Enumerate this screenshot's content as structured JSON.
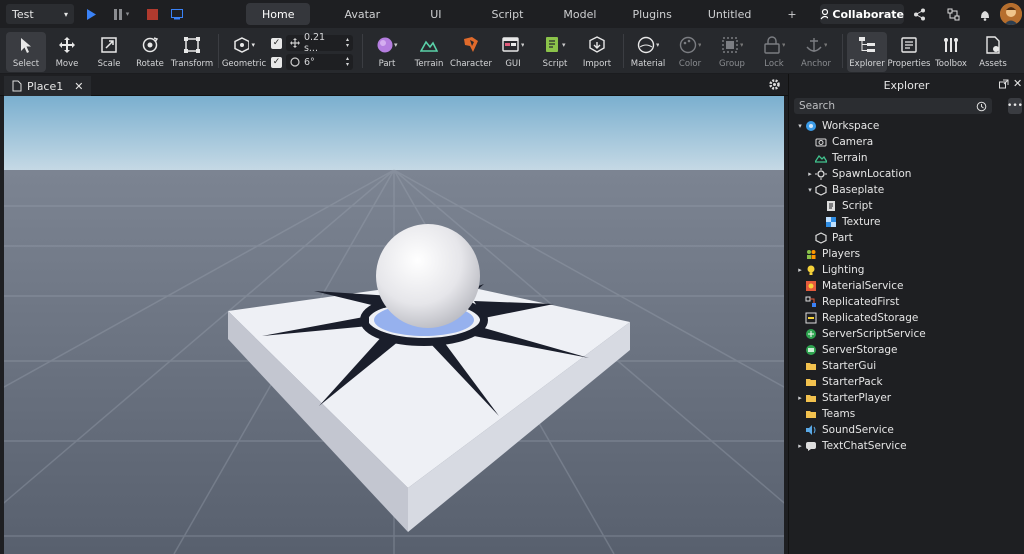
{
  "topbar": {
    "mode": "Test",
    "tabs": [
      "Home",
      "Avatar",
      "UI",
      "Script",
      "Model",
      "Plugins",
      "Untitled",
      "+"
    ],
    "active_tab": "Home",
    "collaborate_label": "Collaborate"
  },
  "ribbon": {
    "tools": [
      "Select",
      "Move",
      "Scale",
      "Rotate",
      "Transform"
    ],
    "geometric_label": "Geometric",
    "snap_move_value": "0.21 s...",
    "snap_rotate_value": "6°",
    "insert": [
      "Part",
      "Terrain",
      "Character",
      "GUI",
      "Script",
      "Import"
    ],
    "edit": [
      "Material",
      "Color",
      "Group",
      "Lock",
      "Anchor"
    ],
    "windows": [
      "Explorer",
      "Properties",
      "Toolbox",
      "Assets"
    ]
  },
  "document": {
    "tab_label": "Place1"
  },
  "explorer": {
    "title": "Explorer",
    "search_placeholder": "Search",
    "tree": [
      {
        "label": "Workspace",
        "depth": 0,
        "arrow": "▾",
        "icon": "workspace-icon"
      },
      {
        "label": "Camera",
        "depth": 1,
        "arrow": "",
        "icon": "camera-icon"
      },
      {
        "label": "Terrain",
        "depth": 1,
        "arrow": "",
        "icon": "terrain-icon"
      },
      {
        "label": "SpawnLocation",
        "depth": 1,
        "arrow": "▸",
        "icon": "spawn-icon"
      },
      {
        "label": "Baseplate",
        "depth": 1,
        "arrow": "▾",
        "icon": "part-icon"
      },
      {
        "label": "Script",
        "depth": 2,
        "arrow": "",
        "icon": "script-icon"
      },
      {
        "label": "Texture",
        "depth": 2,
        "arrow": "",
        "icon": "texture-icon"
      },
      {
        "label": "Part",
        "depth": 1,
        "arrow": "",
        "icon": "part-icon"
      },
      {
        "label": "Players",
        "depth": 0,
        "arrow": "",
        "icon": "players-icon"
      },
      {
        "label": "Lighting",
        "depth": 0,
        "arrow": "▸",
        "icon": "lighting-icon"
      },
      {
        "label": "MaterialService",
        "depth": 0,
        "arrow": "",
        "icon": "material-icon"
      },
      {
        "label": "ReplicatedFirst",
        "depth": 0,
        "arrow": "",
        "icon": "replicated-icon"
      },
      {
        "label": "ReplicatedStorage",
        "depth": 0,
        "arrow": "",
        "icon": "replicated-storage-icon"
      },
      {
        "label": "ServerScriptService",
        "depth": 0,
        "arrow": "",
        "icon": "server-script-icon"
      },
      {
        "label": "ServerStorage",
        "depth": 0,
        "arrow": "",
        "icon": "server-storage-icon"
      },
      {
        "label": "StarterGui",
        "depth": 0,
        "arrow": "",
        "icon": "folder-icon"
      },
      {
        "label": "StarterPack",
        "depth": 0,
        "arrow": "",
        "icon": "folder-icon"
      },
      {
        "label": "StarterPlayer",
        "depth": 0,
        "arrow": "▸",
        "icon": "folder-icon"
      },
      {
        "label": "Teams",
        "depth": 0,
        "arrow": "",
        "icon": "folder-icon"
      },
      {
        "label": "SoundService",
        "depth": 0,
        "arrow": "",
        "icon": "sound-icon"
      },
      {
        "label": "TextChatService",
        "depth": 0,
        "arrow": "▸",
        "icon": "chat-icon"
      }
    ]
  },
  "colors": {
    "accent_blue": "#3a82f7",
    "stop_red": "#c0392b",
    "sky_top": "#7fb0d0",
    "ground": "#5d6573"
  }
}
